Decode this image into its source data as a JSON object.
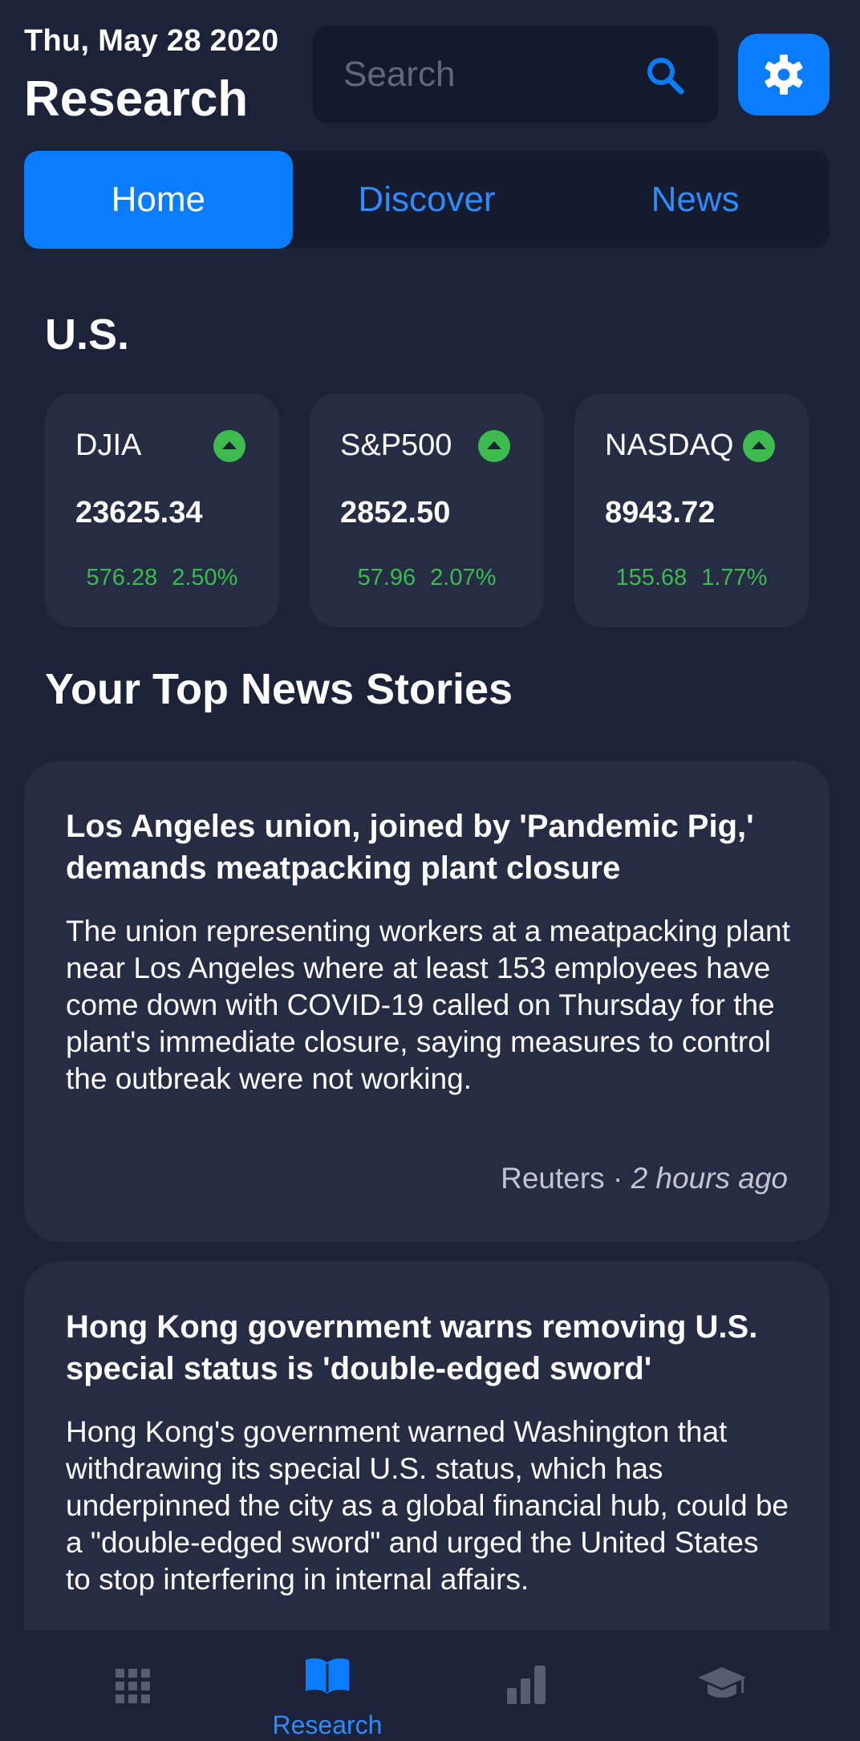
{
  "header": {
    "date": "Thu, May 28 2020",
    "title": "Research",
    "search_placeholder": "Search"
  },
  "tabs": [
    {
      "label": "Home",
      "active": true
    },
    {
      "label": "Discover",
      "active": false
    },
    {
      "label": "News",
      "active": false
    }
  ],
  "market": {
    "heading": "U.S.",
    "tickers": [
      {
        "name": "DJIA",
        "value": "23625.34",
        "change": "576.28",
        "percent": "2.50%",
        "direction": "up"
      },
      {
        "name": "S&P500",
        "value": "2852.50",
        "change": "57.96",
        "percent": "2.07%",
        "direction": "up"
      },
      {
        "name": "NASDAQ",
        "value": "8943.72",
        "change": "155.68",
        "percent": "1.77%",
        "direction": "up"
      }
    ]
  },
  "news": {
    "heading": "Your Top News Stories",
    "stories": [
      {
        "headline": "Los Angeles union, joined by 'Pandemic Pig,' demands meatpacking plant closure",
        "summary": "The union representing workers at a meatpacking plant near Los Angeles where at least 153 employees have come down with COVID-19 called on Thursday for the plant's immediate closure, saying measures to control the outbreak were not working.",
        "source": "Reuters",
        "time": "2 hours ago"
      },
      {
        "headline": "Hong Kong government warns removing U.S. special status is 'double-edged sword'",
        "summary": "Hong Kong's government warned Washington that withdrawing its special U.S. status, which has underpinned the city as a global financial hub, could be a \"double-edged sword\" and urged the United States to stop interfering in internal affairs."
      }
    ]
  },
  "bottom_nav": {
    "items": [
      {
        "icon": "grid-icon",
        "label": ""
      },
      {
        "icon": "book-icon",
        "label": "Research"
      },
      {
        "icon": "bar-chart-icon",
        "label": ""
      },
      {
        "icon": "graduation-cap-icon",
        "label": ""
      }
    ],
    "active_index": 1
  },
  "colors": {
    "background": "#1c2238",
    "card": "#252c44",
    "accent": "#0a7cff",
    "positive": "#3dbb4e",
    "muted_icon": "#565e75"
  }
}
